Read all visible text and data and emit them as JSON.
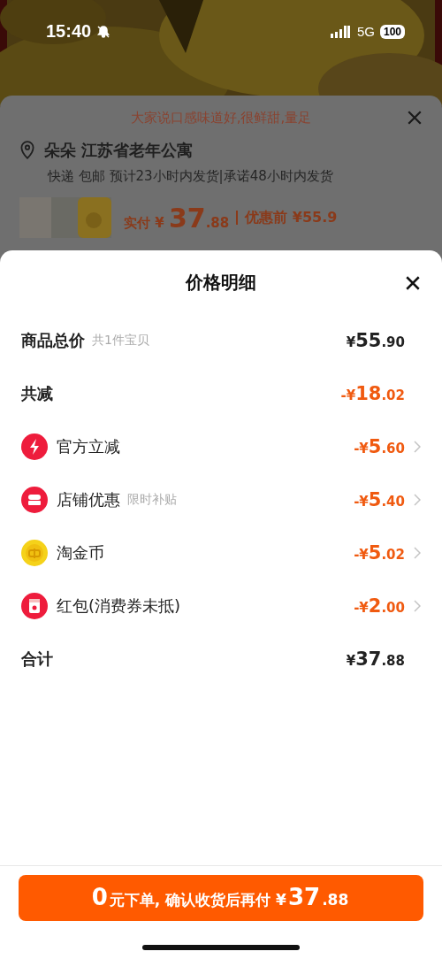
{
  "status_bar": {
    "time": "15:40",
    "network": "5G",
    "battery": "100"
  },
  "background_sheet": {
    "tagline": "大家说口感味道好,很鲜甜,量足",
    "address": "朵朵 江苏省老年公寓",
    "shipping": "快递 包邮 预计23小时内发货|承诺48小时内发货",
    "price_label": "实付",
    "price": {
      "prefix": "¥",
      "whole": "37",
      "fraction": ".88"
    },
    "original_price": "优惠前 ¥55.9"
  },
  "sheet": {
    "title": "价格明细",
    "rows": [
      {
        "kind": "total",
        "label": "商品总价",
        "note": "共1件宝贝",
        "price": {
          "prefix": "¥",
          "whole": "55",
          "fraction": ".90"
        },
        "discount": false,
        "chevron": false
      },
      {
        "kind": "total",
        "label": "共减",
        "price": {
          "prefix": "-¥",
          "whole": "18",
          "fraction": ".02"
        },
        "discount": true,
        "chevron": false
      },
      {
        "kind": "bolt",
        "label": "官方立减",
        "price": {
          "prefix": "-¥",
          "whole": "5",
          "fraction": ".60"
        },
        "discount": true,
        "chevron": true
      },
      {
        "kind": "store",
        "label": "店铺优惠",
        "note": "限时补贴",
        "price": {
          "prefix": "-¥",
          "whole": "5",
          "fraction": ".40"
        },
        "discount": true,
        "chevron": true
      },
      {
        "kind": "coin",
        "label": "淘金币",
        "price": {
          "prefix": "-¥",
          "whole": "5",
          "fraction": ".02"
        },
        "discount": true,
        "chevron": true
      },
      {
        "kind": "redpacket",
        "label": "红包(消费券未抵)",
        "price": {
          "prefix": "-¥",
          "whole": "2",
          "fraction": ".00"
        },
        "discount": true,
        "chevron": true
      },
      {
        "kind": "total",
        "label": "合计",
        "price": {
          "prefix": "¥",
          "whole": "37",
          "fraction": ".88"
        },
        "discount": false,
        "chevron": false
      }
    ],
    "button": [
      {
        "text": "0",
        "big": true
      },
      {
        "text": "元下单, 确认收货后再付 ¥",
        "big": false
      },
      {
        "text": "37",
        "big": true
      },
      {
        "text": ".88",
        "big": false
      }
    ]
  }
}
